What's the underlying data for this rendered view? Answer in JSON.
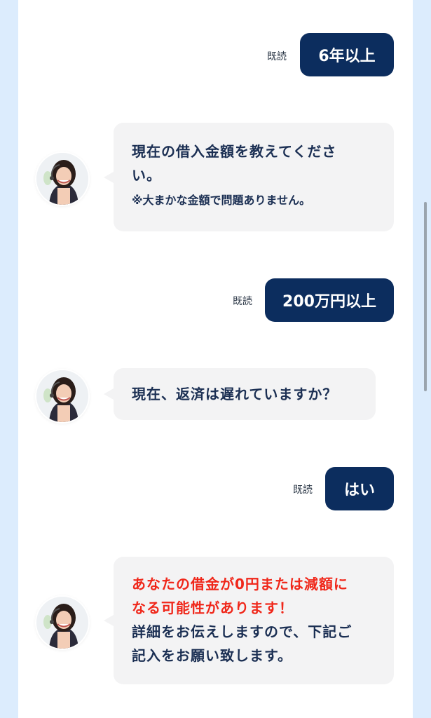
{
  "messages": [
    {
      "type": "user",
      "text": "6年以上",
      "read_label": "既読"
    },
    {
      "type": "bot",
      "lines": [
        "現在の借入金額を教えてくださ",
        "い。"
      ],
      "note": "※大まかな金額で問題ありません。"
    },
    {
      "type": "user",
      "text": "200万円以上",
      "read_label": "既読"
    },
    {
      "type": "bot",
      "lines": [
        "現在、返済は遅れていますか？"
      ]
    },
    {
      "type": "user",
      "text": "はい",
      "read_label": "既読"
    },
    {
      "type": "bot",
      "highlight_lines": [
        "あなたの借金が0円または減額に",
        "なる可能性があります！"
      ],
      "lines": [
        "詳細をお伝えしますので、下記ご",
        "記入をお願い致します。"
      ]
    }
  ],
  "colors": {
    "user_bubble": "#0c2d5e",
    "bot_bubble": "#f3f3f4",
    "bot_text": "#1b2f53",
    "highlight": "#f0271a",
    "background": "#dcecfd"
  },
  "icons": {
    "avatar": "operator-avatar"
  }
}
